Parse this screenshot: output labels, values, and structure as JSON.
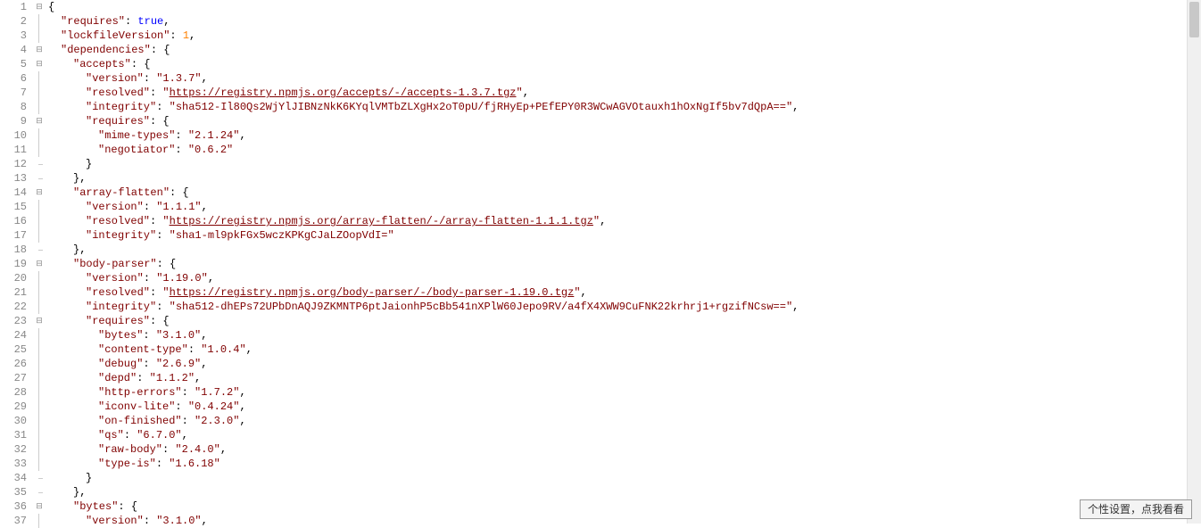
{
  "tooltip": "个性设置，点我看看",
  "lines": [
    {
      "n": 1,
      "fold": "open",
      "indent": 0,
      "parts": [
        {
          "t": "{",
          "c": "p"
        }
      ]
    },
    {
      "n": 2,
      "fold": "line",
      "indent": 1,
      "parts": [
        {
          "t": "\"requires\"",
          "c": "s"
        },
        {
          "t": ": ",
          "c": "p"
        },
        {
          "t": "true",
          "c": "kw"
        },
        {
          "t": ",",
          "c": "p"
        }
      ]
    },
    {
      "n": 3,
      "fold": "line",
      "indent": 1,
      "parts": [
        {
          "t": "\"lockfileVersion\"",
          "c": "s"
        },
        {
          "t": ": ",
          "c": "p"
        },
        {
          "t": "1",
          "c": "num"
        },
        {
          "t": ",",
          "c": "p"
        }
      ]
    },
    {
      "n": 4,
      "fold": "open",
      "indent": 1,
      "parts": [
        {
          "t": "\"dependencies\"",
          "c": "s"
        },
        {
          "t": ": {",
          "c": "p"
        }
      ]
    },
    {
      "n": 5,
      "fold": "open",
      "indent": 2,
      "parts": [
        {
          "t": "\"accepts\"",
          "c": "s"
        },
        {
          "t": ": {",
          "c": "p"
        }
      ]
    },
    {
      "n": 6,
      "fold": "line",
      "indent": 3,
      "parts": [
        {
          "t": "\"version\"",
          "c": "s"
        },
        {
          "t": ": ",
          "c": "p"
        },
        {
          "t": "\"1.3.7\"",
          "c": "s"
        },
        {
          "t": ",",
          "c": "p"
        }
      ]
    },
    {
      "n": 7,
      "fold": "line",
      "indent": 3,
      "parts": [
        {
          "t": "\"resolved\"",
          "c": "s"
        },
        {
          "t": ": ",
          "c": "p"
        },
        {
          "t": "\"",
          "c": "s"
        },
        {
          "t": "https://registry.npmjs.org/accepts/-/accepts-1.3.7.tgz",
          "c": "link"
        },
        {
          "t": "\"",
          "c": "s"
        },
        {
          "t": ",",
          "c": "p"
        }
      ]
    },
    {
      "n": 8,
      "fold": "line",
      "indent": 3,
      "parts": [
        {
          "t": "\"integrity\"",
          "c": "s"
        },
        {
          "t": ": ",
          "c": "p"
        },
        {
          "t": "\"sha512-Il80Qs2WjYlJIBNzNkK6KYqlVMTbZLXgHx2oT0pU/fjRHyEp+PEfEPY0R3WCwAGVOtauxh1hOxNgIf5bv7dQpA==\"",
          "c": "s"
        },
        {
          "t": ",",
          "c": "p"
        }
      ]
    },
    {
      "n": 9,
      "fold": "open",
      "indent": 3,
      "parts": [
        {
          "t": "\"requires\"",
          "c": "s"
        },
        {
          "t": ": {",
          "c": "p"
        }
      ]
    },
    {
      "n": 10,
      "fold": "line",
      "indent": 4,
      "parts": [
        {
          "t": "\"mime-types\"",
          "c": "s"
        },
        {
          "t": ": ",
          "c": "p"
        },
        {
          "t": "\"2.1.24\"",
          "c": "s"
        },
        {
          "t": ",",
          "c": "p"
        }
      ]
    },
    {
      "n": 11,
      "fold": "line",
      "indent": 4,
      "parts": [
        {
          "t": "\"negotiator\"",
          "c": "s"
        },
        {
          "t": ": ",
          "c": "p"
        },
        {
          "t": "\"0.6.2\"",
          "c": "s"
        }
      ]
    },
    {
      "n": 12,
      "fold": "close",
      "indent": 3,
      "parts": [
        {
          "t": "}",
          "c": "p"
        }
      ]
    },
    {
      "n": 13,
      "fold": "close",
      "indent": 2,
      "parts": [
        {
          "t": "},",
          "c": "p"
        }
      ]
    },
    {
      "n": 14,
      "fold": "open",
      "indent": 2,
      "parts": [
        {
          "t": "\"array-flatten\"",
          "c": "s"
        },
        {
          "t": ": {",
          "c": "p"
        }
      ]
    },
    {
      "n": 15,
      "fold": "line",
      "indent": 3,
      "parts": [
        {
          "t": "\"version\"",
          "c": "s"
        },
        {
          "t": ": ",
          "c": "p"
        },
        {
          "t": "\"1.1.1\"",
          "c": "s"
        },
        {
          "t": ",",
          "c": "p"
        }
      ]
    },
    {
      "n": 16,
      "fold": "line",
      "indent": 3,
      "parts": [
        {
          "t": "\"resolved\"",
          "c": "s"
        },
        {
          "t": ": ",
          "c": "p"
        },
        {
          "t": "\"",
          "c": "s"
        },
        {
          "t": "https://registry.npmjs.org/array-flatten/-/array-flatten-1.1.1.tgz",
          "c": "link"
        },
        {
          "t": "\"",
          "c": "s"
        },
        {
          "t": ",",
          "c": "p"
        }
      ]
    },
    {
      "n": 17,
      "fold": "line",
      "indent": 3,
      "parts": [
        {
          "t": "\"integrity\"",
          "c": "s"
        },
        {
          "t": ": ",
          "c": "p"
        },
        {
          "t": "\"sha1-ml9pkFGx5wczKPKgCJaLZOopVdI=\"",
          "c": "s"
        }
      ]
    },
    {
      "n": 18,
      "fold": "close",
      "indent": 2,
      "parts": [
        {
          "t": "},",
          "c": "p"
        }
      ]
    },
    {
      "n": 19,
      "fold": "open",
      "indent": 2,
      "parts": [
        {
          "t": "\"body-parser\"",
          "c": "s"
        },
        {
          "t": ": {",
          "c": "p"
        }
      ]
    },
    {
      "n": 20,
      "fold": "line",
      "indent": 3,
      "parts": [
        {
          "t": "\"version\"",
          "c": "s"
        },
        {
          "t": ": ",
          "c": "p"
        },
        {
          "t": "\"1.19.0\"",
          "c": "s"
        },
        {
          "t": ",",
          "c": "p"
        }
      ]
    },
    {
      "n": 21,
      "fold": "line",
      "indent": 3,
      "parts": [
        {
          "t": "\"resolved\"",
          "c": "s"
        },
        {
          "t": ": ",
          "c": "p"
        },
        {
          "t": "\"",
          "c": "s"
        },
        {
          "t": "https://registry.npmjs.org/body-parser/-/body-parser-1.19.0.tgz",
          "c": "link"
        },
        {
          "t": "\"",
          "c": "s"
        },
        {
          "t": ",",
          "c": "p"
        }
      ]
    },
    {
      "n": 22,
      "fold": "line",
      "indent": 3,
      "parts": [
        {
          "t": "\"integrity\"",
          "c": "s"
        },
        {
          "t": ": ",
          "c": "p"
        },
        {
          "t": "\"sha512-dhEPs72UPbDnAQJ9ZKMNTP6ptJaionhP5cBb541nXPlW60Jepo9RV/a4fX4XWW9CuFNK22krhrj1+rgzifNCsw==\"",
          "c": "s"
        },
        {
          "t": ",",
          "c": "p"
        }
      ]
    },
    {
      "n": 23,
      "fold": "open",
      "indent": 3,
      "parts": [
        {
          "t": "\"requires\"",
          "c": "s"
        },
        {
          "t": ": {",
          "c": "p"
        }
      ]
    },
    {
      "n": 24,
      "fold": "line",
      "indent": 4,
      "parts": [
        {
          "t": "\"bytes\"",
          "c": "s"
        },
        {
          "t": ": ",
          "c": "p"
        },
        {
          "t": "\"3.1.0\"",
          "c": "s"
        },
        {
          "t": ",",
          "c": "p"
        }
      ]
    },
    {
      "n": 25,
      "fold": "line",
      "indent": 4,
      "parts": [
        {
          "t": "\"content-type\"",
          "c": "s"
        },
        {
          "t": ": ",
          "c": "p"
        },
        {
          "t": "\"1.0.4\"",
          "c": "s"
        },
        {
          "t": ",",
          "c": "p"
        }
      ]
    },
    {
      "n": 26,
      "fold": "line",
      "indent": 4,
      "parts": [
        {
          "t": "\"debug\"",
          "c": "s"
        },
        {
          "t": ": ",
          "c": "p"
        },
        {
          "t": "\"2.6.9\"",
          "c": "s"
        },
        {
          "t": ",",
          "c": "p"
        }
      ]
    },
    {
      "n": 27,
      "fold": "line",
      "indent": 4,
      "parts": [
        {
          "t": "\"depd\"",
          "c": "s"
        },
        {
          "t": ": ",
          "c": "p"
        },
        {
          "t": "\"1.1.2\"",
          "c": "s"
        },
        {
          "t": ",",
          "c": "p"
        }
      ]
    },
    {
      "n": 28,
      "fold": "line",
      "indent": 4,
      "parts": [
        {
          "t": "\"http-errors\"",
          "c": "s"
        },
        {
          "t": ": ",
          "c": "p"
        },
        {
          "t": "\"1.7.2\"",
          "c": "s"
        },
        {
          "t": ",",
          "c": "p"
        }
      ]
    },
    {
      "n": 29,
      "fold": "line",
      "indent": 4,
      "parts": [
        {
          "t": "\"iconv-lite\"",
          "c": "s"
        },
        {
          "t": ": ",
          "c": "p"
        },
        {
          "t": "\"0.4.24\"",
          "c": "s"
        },
        {
          "t": ",",
          "c": "p"
        }
      ]
    },
    {
      "n": 30,
      "fold": "line",
      "indent": 4,
      "parts": [
        {
          "t": "\"on-finished\"",
          "c": "s"
        },
        {
          "t": ": ",
          "c": "p"
        },
        {
          "t": "\"2.3.0\"",
          "c": "s"
        },
        {
          "t": ",",
          "c": "p"
        }
      ]
    },
    {
      "n": 31,
      "fold": "line",
      "indent": 4,
      "parts": [
        {
          "t": "\"qs\"",
          "c": "s"
        },
        {
          "t": ": ",
          "c": "p"
        },
        {
          "t": "\"6.7.0\"",
          "c": "s"
        },
        {
          "t": ",",
          "c": "p"
        }
      ]
    },
    {
      "n": 32,
      "fold": "line",
      "indent": 4,
      "parts": [
        {
          "t": "\"raw-body\"",
          "c": "s"
        },
        {
          "t": ": ",
          "c": "p"
        },
        {
          "t": "\"2.4.0\"",
          "c": "s"
        },
        {
          "t": ",",
          "c": "p"
        }
      ]
    },
    {
      "n": 33,
      "fold": "line",
      "indent": 4,
      "parts": [
        {
          "t": "\"type-is\"",
          "c": "s"
        },
        {
          "t": ": ",
          "c": "p"
        },
        {
          "t": "\"1.6.18\"",
          "c": "s"
        }
      ]
    },
    {
      "n": 34,
      "fold": "close",
      "indent": 3,
      "parts": [
        {
          "t": "}",
          "c": "p"
        }
      ]
    },
    {
      "n": 35,
      "fold": "close",
      "indent": 2,
      "parts": [
        {
          "t": "},",
          "c": "p"
        }
      ]
    },
    {
      "n": 36,
      "fold": "open",
      "indent": 2,
      "parts": [
        {
          "t": "\"bytes\"",
          "c": "s"
        },
        {
          "t": ": {",
          "c": "p"
        }
      ]
    },
    {
      "n": 37,
      "fold": "line",
      "indent": 3,
      "parts": [
        {
          "t": "\"version\"",
          "c": "s"
        },
        {
          "t": ": ",
          "c": "p"
        },
        {
          "t": "\"3.1.0\"",
          "c": "s"
        },
        {
          "t": ",",
          "c": "p"
        }
      ]
    }
  ]
}
